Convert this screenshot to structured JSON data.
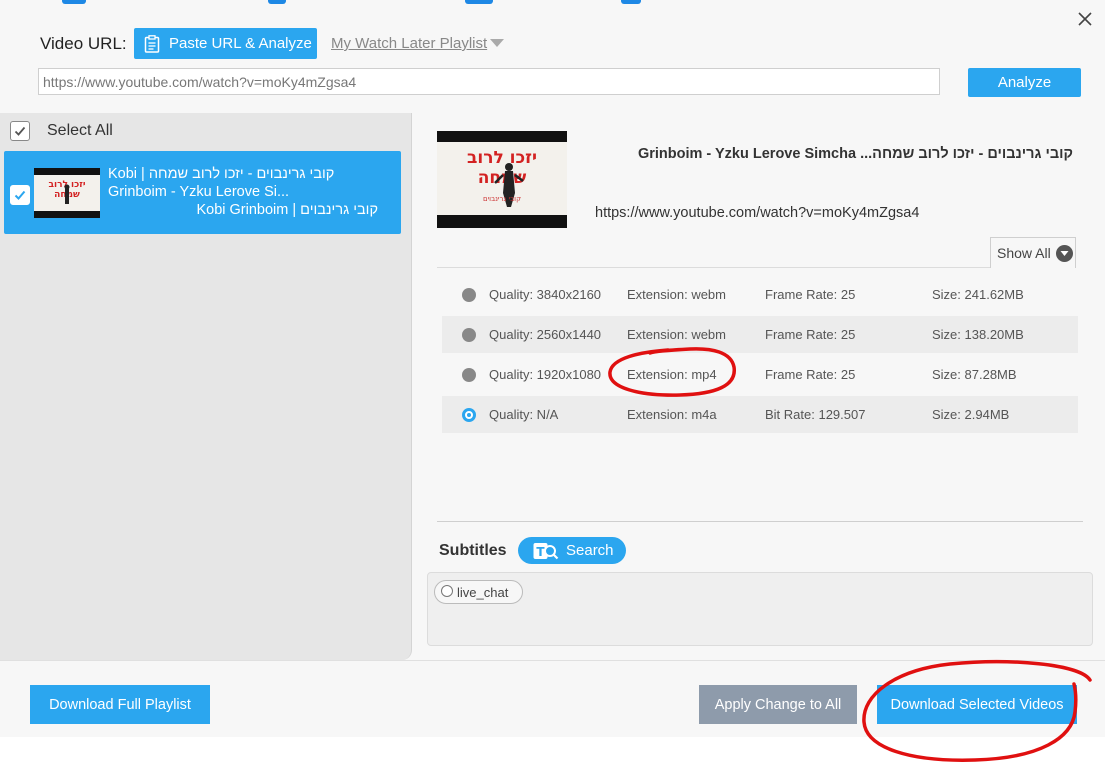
{
  "header": {
    "url_label": "Video URL:",
    "paste_button": "Paste URL & Analyze",
    "watch_later": "My Watch Later Playlist",
    "url_value": "https://www.youtube.com/watch?v=moKy4mZgsa4",
    "analyze_button": "Analyze"
  },
  "playlist": {
    "select_all": "Select All",
    "items": [
      {
        "title_line1": "קובי גרינבוים - יזכו לרוב שמחה | Kobi",
        "title_line2": "Grinboim - Yzku Lerove Si...",
        "title_line3": "קובי גרינבוים | Kobi Grinboim",
        "checked": true
      }
    ]
  },
  "detail": {
    "thumb_text_top": "יזכו לרוב",
    "thumb_text_bottom": "שמחה",
    "thumb_caption": "קובי גרינבוים",
    "title": "קובי גרינבוים - יזכו לרוב שמחה... Grinboim - Yzku Lerove Simcha",
    "url": "https://www.youtube.com/watch?v=moKy4mZgsa4",
    "show_all": "Show All",
    "formats": [
      {
        "quality": "Quality: 3840x2160",
        "extension": "Extension: webm",
        "rate": "Frame Rate: 25",
        "size": "Size: 241.62MB",
        "selected": false
      },
      {
        "quality": "Quality: 2560x1440",
        "extension": "Extension: webm",
        "rate": "Frame Rate: 25",
        "size": "Size: 138.20MB",
        "selected": false
      },
      {
        "quality": "Quality: 1920x1080",
        "extension": "Extension: mp4",
        "rate": "Frame Rate: 25",
        "size": "Size: 87.28MB",
        "selected": false
      },
      {
        "quality": "Quality: N/A",
        "extension": "Extension: m4a",
        "rate": "Bit Rate: 129.507",
        "size": "Size: 2.94MB",
        "selected": true
      }
    ]
  },
  "subtitles": {
    "label": "Subtitles",
    "search_button": "Search",
    "items": [
      "live_chat"
    ]
  },
  "footer": {
    "download_playlist": "Download Full Playlist",
    "apply_all": "Apply Change to All",
    "download_selected": "Download Selected Videos"
  },
  "colors": {
    "accent": "#2ba6ef",
    "annotation": "#e01010",
    "apply_button": "#8e9bab"
  }
}
